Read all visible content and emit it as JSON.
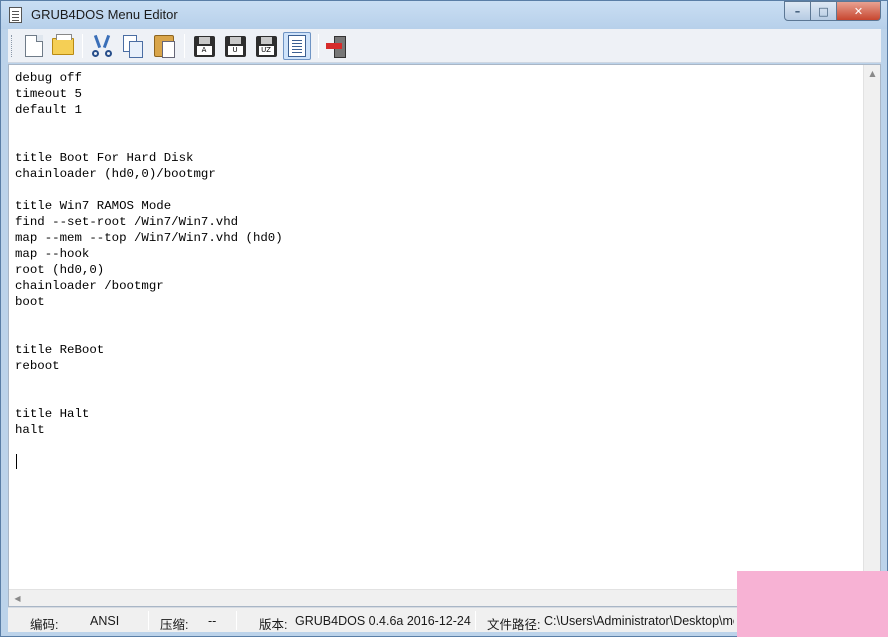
{
  "window": {
    "title": "GRUB4DOS Menu Editor",
    "minimize_glyph": "–",
    "maximize_glyph": "□",
    "close_glyph": "✕"
  },
  "toolbar": {
    "buttons": [
      {
        "icon": "new-file-icon"
      },
      {
        "icon": "open-folder-icon"
      },
      {
        "icon": "cut-icon"
      },
      {
        "icon": "copy-icon"
      },
      {
        "icon": "paste-icon"
      },
      {
        "icon": "save-ansi-icon",
        "label": "A"
      },
      {
        "icon": "save-unicode-icon",
        "label": "U"
      },
      {
        "icon": "save-utf8-icon",
        "label": "UZ"
      },
      {
        "icon": "text-view-icon"
      },
      {
        "icon": "exit-icon"
      }
    ]
  },
  "editor": {
    "lines": [
      "debug off",
      "timeout 5",
      "default 1",
      "",
      "",
      "title Boot For Hard Disk",
      "chainloader (hd0,0)/bootmgr",
      "",
      "title Win7 RAMOS Mode",
      "find --set-root /Win7/Win7.vhd",
      "map --mem --top /Win7/Win7.vhd (hd0)",
      "map --hook",
      "root (hd0,0)",
      "chainloader /bootmgr",
      "boot",
      "",
      "",
      "title ReBoot",
      "reboot",
      "",
      "",
      "title Halt",
      "halt",
      "",
      ""
    ]
  },
  "scrollbars": {
    "up_glyph": "▲",
    "down_glyph": "▼",
    "left_glyph": "◀",
    "right_glyph": "▶"
  },
  "statusbar": {
    "encoding_label": "编码:",
    "encoding_value": "ANSI",
    "compression_label": "压缩:",
    "compression_value": "--",
    "version_label": "版本:",
    "version_value": "GRUB4DOS 0.4.6a 2016-12-24",
    "path_label": "文件路径:",
    "path_value": "C:\\Users\\Administrator\\Desktop\\menu.lst"
  },
  "colors": {
    "frame": "#bcd3ea",
    "close_button": "#c7462f",
    "toolbar": "#eef1f6",
    "overlay": "#f7b2d4"
  }
}
